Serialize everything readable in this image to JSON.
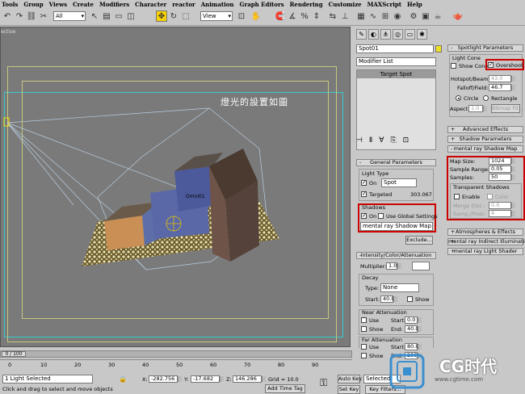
{
  "menu": [
    "Tools",
    "Group",
    "Views",
    "Create",
    "Modifiers",
    "Character",
    "reactor",
    "Animation",
    "Graph Editors",
    "Rendering",
    "Customize",
    "MAXScript",
    "Help"
  ],
  "toolbar": {
    "selection_filter": "All",
    "ref_coord": "View"
  },
  "viewport": {
    "label": "ective",
    "annotation": "燈光的設置如圖",
    "omni_label": "Omni01"
  },
  "command_panel": {
    "object_name": "Spot01",
    "modifier_list": "Modifier List",
    "stack_item": "Target Spot",
    "general": {
      "title": "General Parameters",
      "light_type_label": "Light Type",
      "on_label": "On",
      "type_value": "Spot",
      "targeted_label": "Targeted",
      "target_distance": "303.067",
      "shadows_label": "Shadows",
      "shadow_on_label": "On",
      "use_global_label": "Use Global Settings",
      "shadow_type": "mental ray Shadow Map",
      "exclude_label": "Exclude..."
    },
    "intensity": {
      "title": "Intensity/Color/Attenuation",
      "multiplier_label": "Multiplier:",
      "multiplier_value": "1.0",
      "decay_label": "Decay",
      "type_label": "Type:",
      "type_value": "None",
      "start_label": "Start:",
      "start_value": "40.0",
      "show_label": "Show",
      "near_label": "Near Attenuation",
      "use_label": "Use",
      "near_start": "0.0",
      "near_show": "Show",
      "end_label": "End:",
      "near_end": "40.0",
      "far_label": "Far Attenuation",
      "far_use": "Use",
      "far_start": "80.0",
      "far_show": "Show",
      "far_end": "200.0"
    },
    "spotlight": {
      "title": "Spotlight Parameters",
      "cone_label": "Light Cone",
      "show_cone_label": "Show Cone",
      "overshoot_label": "Overshoot",
      "hotspot_label": "Hotspot/Beam:",
      "hotspot_value": "43.0",
      "falloff_label": "Falloff/Field:",
      "falloff_value": "46.7",
      "circle_label": "Circle",
      "rectangle_label": "Rectangle",
      "aspect_label": "Aspect:",
      "aspect_value": "1.0",
      "bitmap_fit_label": "Bitmap Fit..."
    },
    "rollouts": {
      "advanced_effects": "Advanced Effects",
      "shadow_params": "Shadow Parameters",
      "mr_shadow_map": "mental ray Shadow Map",
      "atmospheres": "Atmospheres & Effects",
      "mr_indirect": "mental ray Indirect Illumination",
      "mr_light_shader": "mental ray Light Shader"
    },
    "mr_shadow": {
      "map_size_label": "Map Size:",
      "map_size": "1024",
      "sample_range_label": "Sample Range:",
      "sample_range": "0.05",
      "samples_label": "Samples:",
      "samples": "50",
      "transparent_label": "Transparent Shadows",
      "enable_label": "Enable",
      "color_label": "Color",
      "merge_label": "Merge Dist.:",
      "merge_value": "0.0",
      "samp_pixel_label": "Samp./Pixel:",
      "samp_pixel_value": "4"
    }
  },
  "timeline": {
    "frame": "0 / 100",
    "ticks": [
      "0",
      "10",
      "20",
      "30",
      "40",
      "50",
      "60",
      "70",
      "80",
      "90"
    ]
  },
  "status": {
    "selected": "1 Light Selected",
    "prompt": "Click and drag to select and move objects",
    "x_label": "X:",
    "x_value": "-282.756",
    "y_label": "Y:",
    "y_value": "-17.682",
    "z_label": "Z:",
    "z_value": "146.286",
    "grid": "Grid = 10.0",
    "add_time_tag": "Add Time Tag",
    "auto_key": "Auto Key",
    "set_key": "Set Key",
    "selected_dd": "Selected",
    "key_filters": "Key Filters..."
  },
  "watermark": {
    "brand": "CG时代",
    "url": "www.cgtime.com"
  }
}
